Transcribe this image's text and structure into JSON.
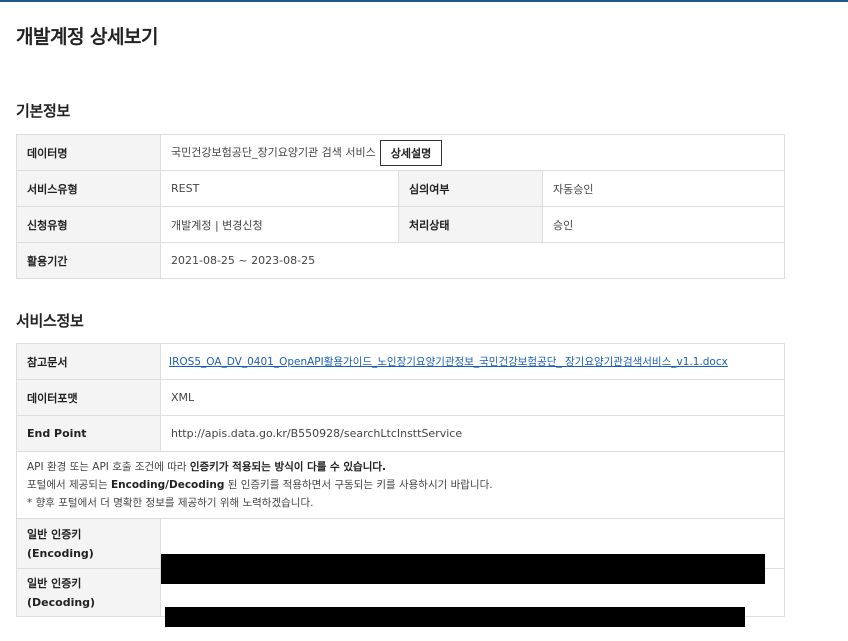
{
  "page": {
    "title": "개발계정 상세보기"
  },
  "basic": {
    "section_title": "기본정보",
    "data_name_label": "데이터명",
    "data_name_value": "국민건강보험공단_장기요양기관 검색 서비스",
    "detail_button": "상세설명",
    "service_type_label": "서비스유형",
    "service_type_value": "REST",
    "review_label": "심의여부",
    "review_value": "자동승인",
    "request_type_label": "신청유형",
    "request_type_value": "개발계정 | 변경신청",
    "status_label": "처리상태",
    "status_value": "승인",
    "period_label": "활용기간",
    "period_value": "2021-08-25 ~ 2023-08-25"
  },
  "service": {
    "section_title": "서비스정보",
    "doc_label": "참고문서",
    "doc_value": "IROS5_OA_DV_0401_OpenAPI활용가이드_노인장기요양기관정보_국민건강보험공단_ 장기요양기관검색서비스_v1.1.docx",
    "format_label": "데이터포맷",
    "format_value": "XML",
    "endpoint_label": "End Point",
    "endpoint_value": "http://apis.data.go.kr/B550928/searchLtcInsttService",
    "notice_line1_a": "API 환경 또는 API 호출 조건에 따라 ",
    "notice_line1_b": "인증키가 적용되는 방식이 다를 수 있습니다.",
    "notice_line2_a": "포털에서 제공되는 ",
    "notice_line2_b": "Encoding/Decoding",
    "notice_line2_c": " 된 인증키를 적용하면서 구동되는 키를 사용하시기 바랍니다.",
    "notice_line3": "* 향후 포털에서 더 명확한 정보를 제공하기 위해 노력하겠습니다.",
    "key_enc_label_1": "일반 인증키",
    "key_enc_label_2": "(Encoding)",
    "key_dec_label_1": "일반 인증키",
    "key_dec_label_2": "(Decoding)"
  }
}
